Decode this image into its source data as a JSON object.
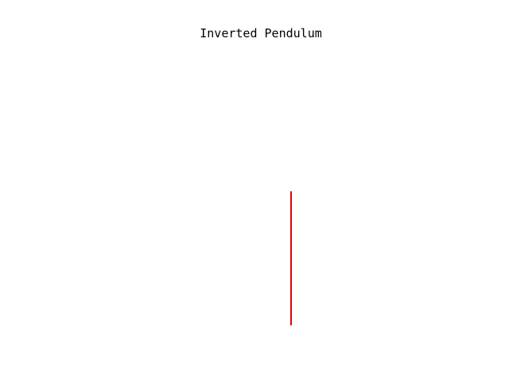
{
  "window": {
    "title": "Inverted Pendulum",
    "background": "#ffffff"
  },
  "pendulum": {
    "pole_color": "#e00000",
    "angle_deg": 0
  }
}
